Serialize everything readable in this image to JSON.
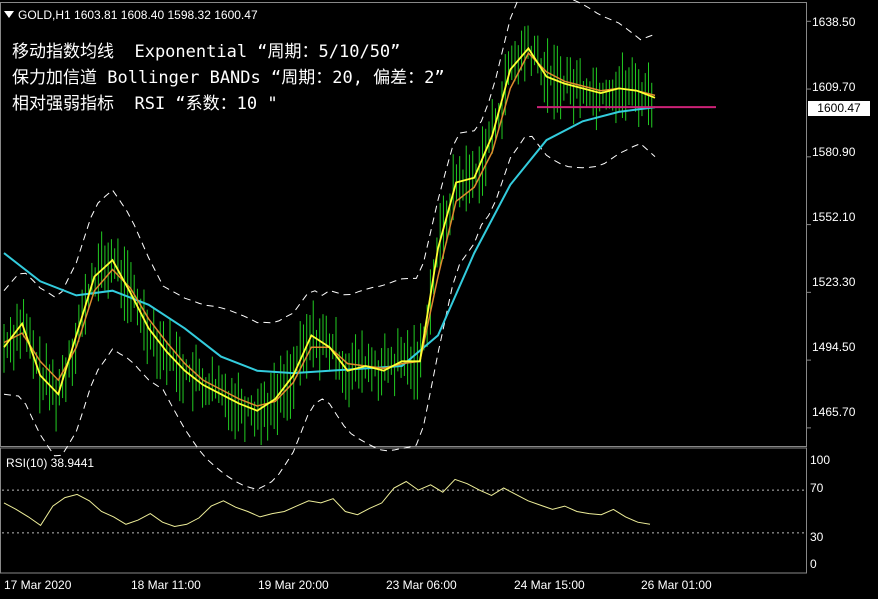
{
  "header": {
    "symbol": "GOLD,H1",
    "open": "1603.81",
    "high": "1608.40",
    "low": "1598.32",
    "close": "1600.47"
  },
  "annotations": [
    "移动指数均线  Exponential “周期：5/10/50”",
    "保力加信道 Bollinger BANDs “周期：20, 偏差：2”",
    "相对强弱指标  RSI “系数：10 \""
  ],
  "price_tag": "1600.47",
  "rsi_label": "RSI(10) 38.9441",
  "colors": {
    "bg": "#000000",
    "price": "#22cc22",
    "ema5": "#ffff33",
    "ema10": "#e08a2e",
    "ema50": "#33ccdd",
    "bands": "#ffffff",
    "support": "#cc2277",
    "rsi": "#eeee99"
  },
  "chart_data": [
    {
      "type": "line",
      "title": "GOLD,H1",
      "x_ticks": [
        "17 Mar 2020",
        "18 Mar 11:00",
        "19 Mar 20:00",
        "23 Mar 06:00",
        "24 Mar 15:00",
        "26 Mar 01:00"
      ],
      "y_ticks": [
        "1638.50",
        "1609.70",
        "1580.90",
        "1552.10",
        "1523.30",
        "1494.50",
        "1465.70"
      ],
      "ylim": [
        1458,
        1645
      ],
      "series": [
        {
          "name": "EMA5",
          "x": [
            0,
            5,
            10,
            15,
            20,
            25,
            30,
            35,
            40,
            45,
            50,
            55,
            60,
            65,
            70,
            75,
            80,
            85,
            90,
            95,
            100,
            105,
            110,
            115,
            120,
            125,
            130,
            135,
            140,
            145,
            150,
            155,
            160,
            165,
            170,
            175,
            180
          ],
          "values": [
            1500,
            1510,
            1488,
            1480,
            1505,
            1530,
            1537,
            1523,
            1508,
            1498,
            1490,
            1484,
            1480,
            1476,
            1473,
            1478,
            1488,
            1505,
            1500,
            1490,
            1492,
            1490,
            1494,
            1494,
            1542,
            1570,
            1572,
            1590,
            1618,
            1627,
            1615,
            1612,
            1610,
            1608,
            1610,
            1609,
            1606
          ]
        },
        {
          "name": "EMA10",
          "x": [
            0,
            5,
            10,
            15,
            20,
            25,
            30,
            35,
            40,
            45,
            50,
            55,
            60,
            65,
            70,
            75,
            80,
            85,
            90,
            95,
            100,
            105,
            110,
            115,
            120,
            125,
            130,
            135,
            140,
            145,
            150,
            155,
            160,
            165,
            170,
            175,
            180
          ],
          "values": [
            1502,
            1506,
            1494,
            1486,
            1500,
            1524,
            1533,
            1525,
            1512,
            1502,
            1493,
            1486,
            1482,
            1478,
            1475,
            1477,
            1485,
            1500,
            1500,
            1493,
            1492,
            1491,
            1493,
            1494,
            1530,
            1562,
            1568,
            1583,
            1610,
            1625,
            1617,
            1613,
            1611,
            1609,
            1610,
            1609,
            1607
          ]
        },
        {
          "name": "EMA50",
          "x": [
            0,
            10,
            20,
            30,
            40,
            50,
            60,
            70,
            80,
            90,
            100,
            110,
            120,
            130,
            140,
            150,
            160,
            170,
            180
          ],
          "values": [
            1540,
            1528,
            1522,
            1524,
            1518,
            1508,
            1496,
            1490,
            1489,
            1490,
            1491,
            1492,
            1505,
            1540,
            1569,
            1588,
            1596,
            1600,
            1602
          ]
        }
      ],
      "support_level": 1602
    },
    {
      "type": "line",
      "title": "RSI(10) 38.9441",
      "y_ticks": [
        "100",
        "70",
        "30",
        "0"
      ],
      "ylim": [
        0,
        100
      ],
      "levels": [
        70,
        30
      ],
      "values": [
        58,
        52,
        45,
        37,
        55,
        63,
        66,
        60,
        50,
        45,
        38,
        42,
        48,
        40,
        36,
        38,
        44,
        55,
        60,
        54,
        50,
        45,
        48,
        50,
        55,
        60,
        58,
        62,
        50,
        47,
        53,
        58,
        72,
        78,
        70,
        75,
        68,
        80,
        76,
        70,
        65,
        72,
        66,
        60,
        56,
        52,
        55,
        50,
        48,
        47,
        52,
        45,
        40,
        38
      ]
    }
  ]
}
